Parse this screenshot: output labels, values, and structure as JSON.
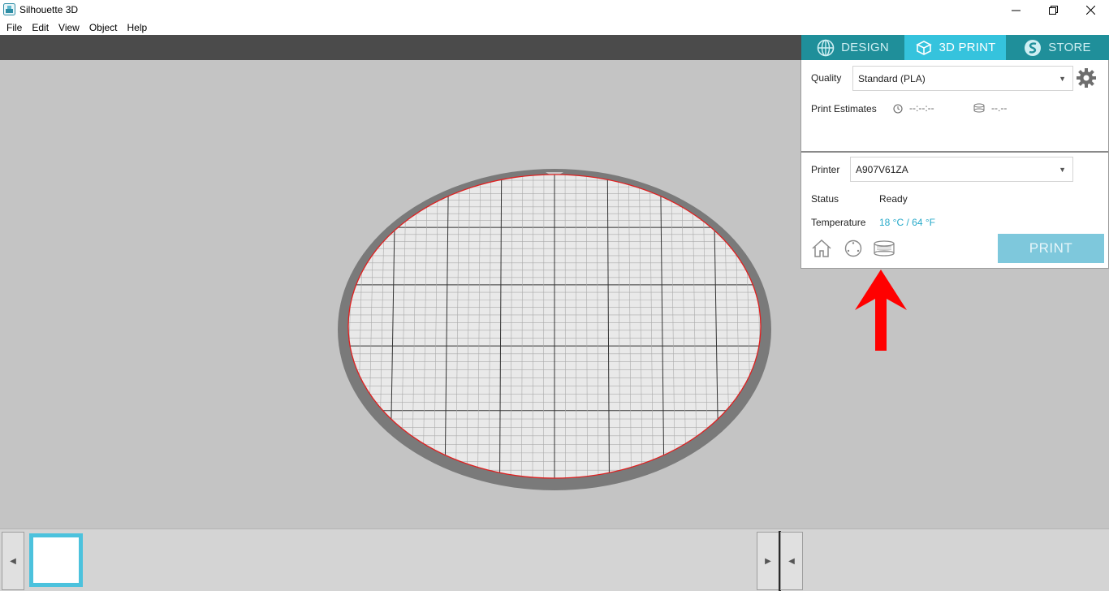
{
  "window": {
    "title": "Silhouette 3D"
  },
  "menu": [
    "File",
    "Edit",
    "View",
    "Object",
    "Help"
  ],
  "tabs": {
    "design": "DESIGN",
    "print": "3D PRINT",
    "store": "STORE"
  },
  "panel": {
    "quality_label": "Quality",
    "quality_value": "Standard (PLA)",
    "estimates_label": "Print Estimates",
    "time_estimate": "--:--:--",
    "material_estimate": "--.--",
    "printer_label": "Printer",
    "printer_value": "A907V61ZA",
    "status_label": "Status",
    "status_value": "Ready",
    "temperature_label": "Temperature",
    "temperature_value": "18 °C / 64 °F",
    "print_button": "PRINT"
  },
  "colors": {
    "accent": "#35c3dd",
    "tab_inactive": "#1f8f9a",
    "annotation_arrow": "#ff0000",
    "bed_outline": "#e02020"
  },
  "icons": [
    "app-icon",
    "minimize-icon",
    "restore-icon",
    "close-icon",
    "globe-icon",
    "cube-icon",
    "s-logo-icon",
    "gear-icon",
    "clock-icon",
    "spool-icon",
    "home-icon",
    "level-icon",
    "filament-icon",
    "chevron-left-icon",
    "chevron-right-icon"
  ]
}
